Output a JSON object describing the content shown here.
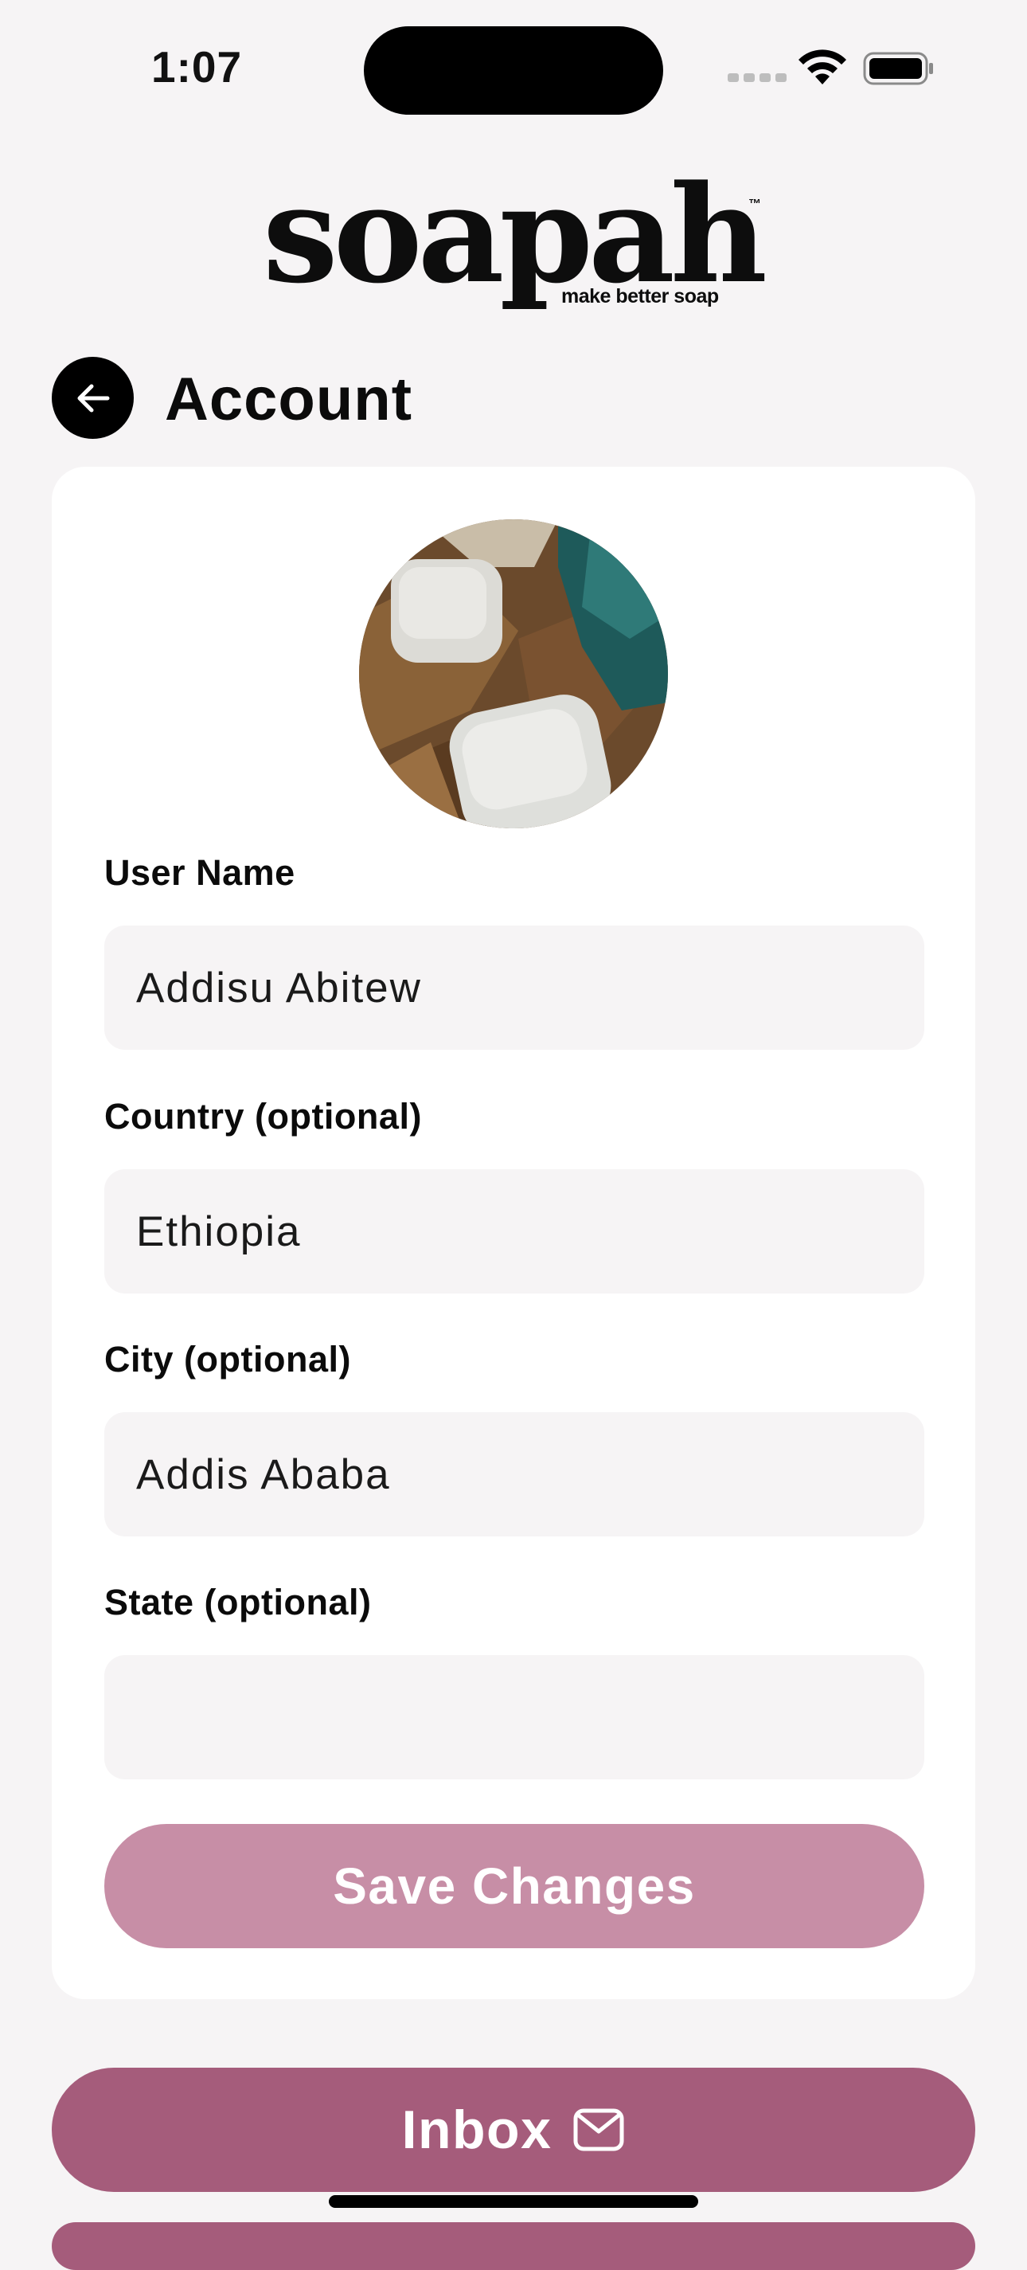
{
  "status_bar": {
    "time": "1:07"
  },
  "logo": {
    "wordmark": "soapah",
    "trademark": "™",
    "tagline": "make better soap"
  },
  "header": {
    "title": "Account",
    "back_icon": "arrow-left-icon"
  },
  "form": {
    "fields": [
      {
        "label": "User Name",
        "value": "Addisu Abitew"
      },
      {
        "label": "Country (optional)",
        "value": "Ethiopia"
      },
      {
        "label": "City (optional)",
        "value": "Addis Ababa"
      },
      {
        "label": "State (optional)",
        "value": ""
      }
    ],
    "save_label": "Save Changes"
  },
  "inbox": {
    "label": "Inbox",
    "icon": "envelope-icon"
  },
  "colors": {
    "background": "#f6f4f5",
    "card": "#ffffff",
    "save_button": "#c78ea6",
    "inbox_button": "#a55c7b",
    "input_background": "#f6f4f5"
  }
}
